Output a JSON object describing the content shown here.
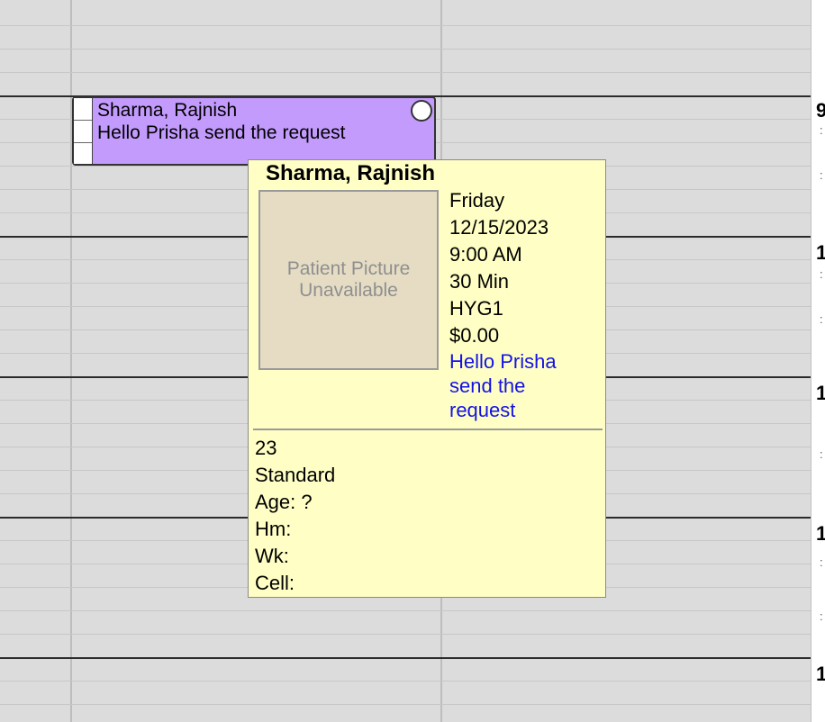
{
  "schedule": {
    "hour_labels": [
      "9",
      "1",
      "1",
      "1",
      "1"
    ],
    "minute_ticks": [
      ":",
      ":",
      ":",
      ":",
      ":",
      ":",
      ":"
    ]
  },
  "appointment": {
    "patient_name": "Sharma, Rajnish",
    "note": "Hello Prisha send the request",
    "color": "#c39bfd"
  },
  "tooltip": {
    "patient_name": "Sharma, Rajnish",
    "picture_line1": "Patient Picture",
    "picture_line2": "Unavailable",
    "day": "Friday",
    "date": "12/15/2023",
    "time": "9:00 AM",
    "length": "30 Min",
    "operatory": "HYG1",
    "fee": "$0.00",
    "note_line1": "Hello Prisha",
    "note_line2": "send the",
    "note_line3": "request",
    "pat_num": "23",
    "fee_schedule": "Standard",
    "age": "Age: ?",
    "home_phone": "Hm:",
    "work_phone": "Wk:",
    "cell_phone": "Cell:",
    "background_color": "#ffffc5",
    "note_color": "#1313e6"
  }
}
